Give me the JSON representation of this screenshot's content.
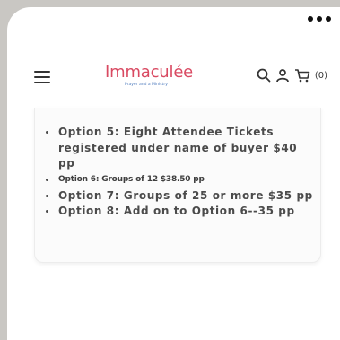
{
  "header": {
    "logo_text": "Immaculée",
    "logo_tagline": "Prayer and a Ministry",
    "cart_count": "(0)"
  },
  "options": [
    {
      "text": "Option 5: Eight Attendee Tickets registered under name of buyer $40 pp",
      "size": "big"
    },
    {
      "text": "Option 6: Groups of 12 $38.50 pp",
      "size": "small"
    },
    {
      "text": "Option 7: Groups of 25 or more $35 pp",
      "size": "big"
    },
    {
      "text": "Option 8: Add on to Option 6--35 pp",
      "size": "big"
    }
  ],
  "colors": {
    "logo_red": "#d94a62",
    "logo_magenta": "#c03a8e",
    "tagline_blue": "#4e7bbd",
    "backdrop": "#c9c7c3"
  }
}
